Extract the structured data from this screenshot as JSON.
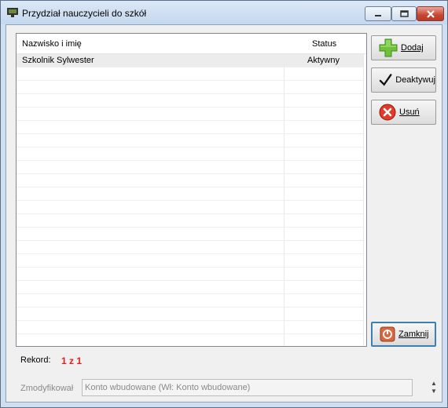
{
  "window": {
    "title": "Przydział nauczycieli do szkół",
    "icon": "app-window-icon"
  },
  "grid": {
    "columns": [
      "Nazwisko i imię",
      "Status"
    ],
    "rows": [
      {
        "name": "Szkolnik Sylwester",
        "status": "Aktywny"
      }
    ]
  },
  "buttons": {
    "add": {
      "label": "Dodaj",
      "icon": "plus-icon"
    },
    "deactivate": {
      "label": "Deaktywuj",
      "icon": "checkmark-icon"
    },
    "delete": {
      "label": "Usuń",
      "icon": "delete-icon"
    },
    "close": {
      "label": "Zamknij",
      "icon": "exit-icon"
    }
  },
  "record": {
    "label": "Rekord:",
    "value": "1 z 1"
  },
  "modified": {
    "label": "Zmodyfikował",
    "value": "Konto wbudowane (Wł: Konto wbudowane)"
  }
}
